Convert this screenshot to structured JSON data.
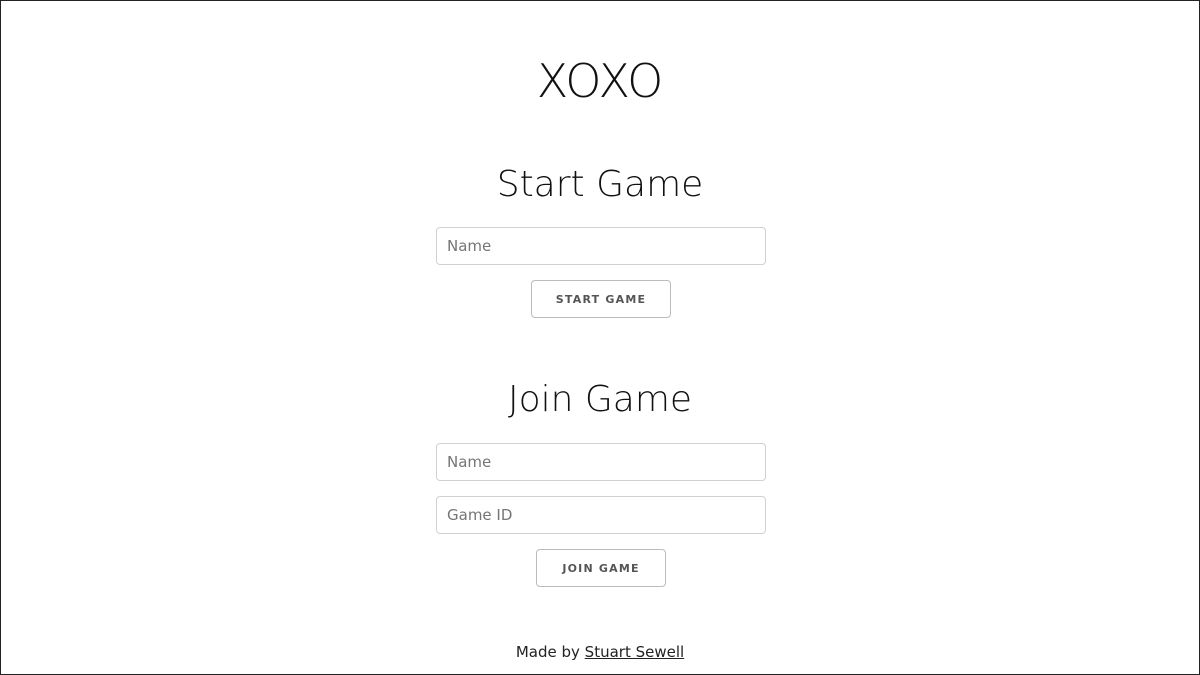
{
  "app": {
    "title": "XOXO"
  },
  "start_section": {
    "heading": "Start Game",
    "name_placeholder": "Name",
    "name_value": "",
    "button_label": "START GAME"
  },
  "join_section": {
    "heading": "Join Game",
    "name_placeholder": "Name",
    "name_value": "",
    "game_id_placeholder": "Game ID",
    "game_id_value": "",
    "button_label": "JOIN GAME"
  },
  "footer": {
    "prefix": "Made by",
    "author_link": "Stuart Sewell"
  },
  "colors": {
    "background": "#ffffff",
    "text": "#111111",
    "input_border": "#d1d1d1",
    "button_border": "#bbbbbb"
  }
}
